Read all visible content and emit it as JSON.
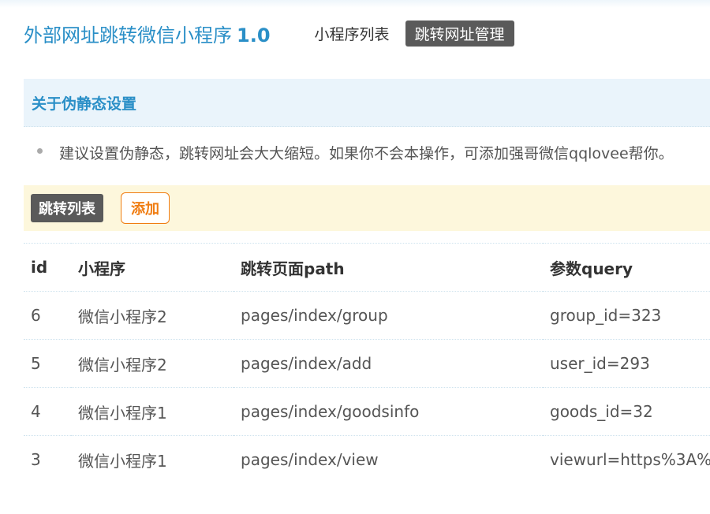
{
  "header": {
    "app_title": "外部网址跳转微信小程序",
    "version": "1.0",
    "nav": [
      {
        "label": "小程序列表",
        "active": false
      },
      {
        "label": "跳转网址管理",
        "active": true
      }
    ]
  },
  "rewrite_section": {
    "title": "关于伪静态设置",
    "tip": "建议设置伪静态，跳转网址会大大缩短。如果你不会本操作，可添加强哥微信qqlovee帮你。"
  },
  "list_section": {
    "label": "跳转列表",
    "add_button": "添加"
  },
  "table": {
    "columns": [
      "id",
      "小程序",
      "跳转页面path",
      "参数query"
    ],
    "rows": [
      {
        "id": "6",
        "app": "微信小程序2",
        "path": "pages/index/group",
        "query": "group_id=323"
      },
      {
        "id": "5",
        "app": "微信小程序2",
        "path": "pages/index/add",
        "query": "user_id=293"
      },
      {
        "id": "4",
        "app": "微信小程序1",
        "path": "pages/index/goodsinfo",
        "query": "goods_id=32"
      },
      {
        "id": "3",
        "app": "微信小程序1",
        "path": "pages/index/view",
        "query": "viewurl=https%3A%"
      }
    ]
  },
  "colors": {
    "brand": "#2a8fc7",
    "active_tab": "#5a5a5a",
    "add_button": "#f07d12",
    "section_bg": "#eaf4fb",
    "list_bg": "#fdf7dc"
  }
}
